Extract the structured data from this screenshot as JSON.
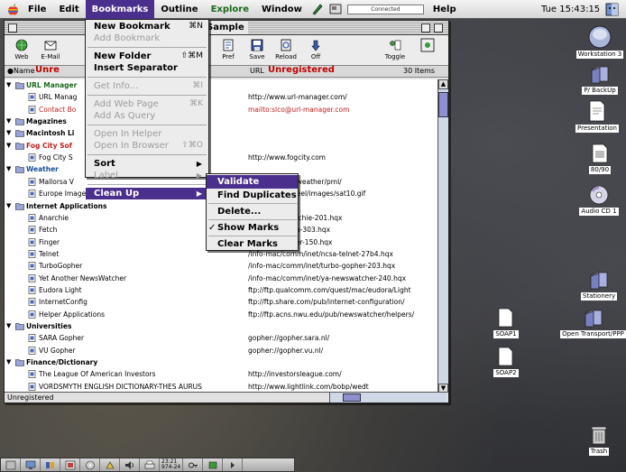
{
  "menubar": {
    "items": [
      "File",
      "Edit",
      "Bookmarks",
      "Outline",
      "Explore",
      "Window"
    ],
    "active": "Bookmarks",
    "connected_status": "Connected",
    "help": "Help",
    "clock": "Tue 15:43:15"
  },
  "window": {
    "title": "Sample",
    "toolbar": [
      {
        "label": "Web",
        "icon": "web-icon"
      },
      {
        "label": "E-Mail",
        "icon": "email-icon"
      },
      {
        "label": "Pref",
        "icon": "pref-icon"
      },
      {
        "label": "Save",
        "icon": "save-icon"
      },
      {
        "label": "Reload",
        "icon": "reload-icon"
      },
      {
        "label": "Off",
        "icon": "off-icon"
      },
      {
        "label": "Toggle",
        "icon": "toggle-icon"
      }
    ],
    "header": {
      "name_col": "Name",
      "unreg_left": "Unre",
      "url_col": "URL",
      "unreg_right": "Unregistered",
      "count": "30 Items"
    },
    "rows": [
      {
        "name": "URL Manager",
        "url": "",
        "kind": "folder",
        "color": "green",
        "indent": 0
      },
      {
        "name": "URL Manag",
        "url": "http://www.url-manager.com/",
        "kind": "item",
        "color": "",
        "indent": 1
      },
      {
        "name": "Contact Bo",
        "url": "mailto:slco@url-manager.com",
        "kind": "item",
        "color": "red",
        "indent": 1
      },
      {
        "name": "Magazines",
        "url": "",
        "kind": "folder",
        "color": "",
        "indent": 0
      },
      {
        "name": "Macintosh Li",
        "url": "",
        "kind": "folder",
        "color": "",
        "indent": 0
      },
      {
        "name": "Fog City Sof",
        "url": "",
        "kind": "folder",
        "color": "red",
        "indent": 0
      },
      {
        "name": "Fog City S",
        "url": "http://www.fogcity.com",
        "kind": "item",
        "color": "",
        "indent": 1
      },
      {
        "name": "Weather",
        "url": "",
        "kind": "folder",
        "color": "blue",
        "indent": 0
      },
      {
        "name": "Mallorsa V",
        "url": "telliteast.com/weather/pml/",
        "kind": "item",
        "color": "",
        "indent": 1
      },
      {
        "name": "Europe Image",
        "url": "eteo.fr:80/tpsreel/images/sat10.gif",
        "kind": "item",
        "color": "",
        "indent": 1
      },
      {
        "name": "Internet Applications",
        "url": "",
        "kind": "folder",
        "color": "",
        "indent": 0
      },
      {
        "name": "Anarchie",
        "url": "omm/inet/anarchie-201.hqx",
        "kind": "item",
        "color": "",
        "indent": 1
      },
      {
        "name": "Fetch",
        "url": "omm/inet/fetch-303.hqx",
        "kind": "item",
        "color": "",
        "indent": 1
      },
      {
        "name": "Finger",
        "url": "omm/inet/finger-150.hqx",
        "kind": "item",
        "color": "",
        "indent": 1
      },
      {
        "name": "Telnet",
        "url": "/info-mac/comm/inet/ncsa-telnet-27b4.hqx",
        "kind": "item",
        "color": "",
        "indent": 1
      },
      {
        "name": "TurboGopher",
        "url": "/info-mac/comm/inet/turbo-gopher-203.hqx",
        "kind": "item",
        "color": "",
        "indent": 1
      },
      {
        "name": "Yet Another NewsWatcher",
        "url": "/info-mac/comm/inet/ya-newswatcher-240.hqx",
        "kind": "item",
        "color": "",
        "indent": 1
      },
      {
        "name": "Eudora Light",
        "url": "ftp://ftp.qualcomm.com/quest/mac/eudora/Light",
        "kind": "item",
        "color": "",
        "indent": 1
      },
      {
        "name": "InternetConfig",
        "url": "ftp://ftp.share.com/pub/internet-configuration/",
        "kind": "item",
        "color": "",
        "indent": 1
      },
      {
        "name": "Helper Applications",
        "url": "ftp://ftp.acns.nwu.edu/pub/newswatcher/helpers/",
        "kind": "item",
        "color": "",
        "indent": 1
      },
      {
        "name": "Universities",
        "url": "",
        "kind": "folder",
        "color": "",
        "indent": 0
      },
      {
        "name": "SARA Gopher",
        "url": "gopher://gopher.sara.nl/",
        "kind": "item",
        "color": "",
        "indent": 1
      },
      {
        "name": "VU Gopher",
        "url": "gopher://gopher.vu.nl/",
        "kind": "item",
        "color": "",
        "indent": 1
      },
      {
        "name": "Finance/Dictionary",
        "url": "",
        "kind": "folder",
        "color": "",
        "indent": 0
      },
      {
        "name": "The League Of American Investors",
        "url": "http://investorsleague.com/",
        "kind": "item",
        "color": "",
        "indent": 1
      },
      {
        "name": "VORDSMYTH ENGLISH DICTIONARY-THES AURUS",
        "url": "http://www.lightlink.com/bobp/wedt",
        "kind": "item",
        "color": "",
        "indent": 1
      }
    ],
    "status": "Unregistered"
  },
  "bookmarks_menu": [
    {
      "label": "New Bookmark",
      "shortcut": "⌘N",
      "disabled": false
    },
    {
      "label": "Add Bookmark",
      "shortcut": "",
      "disabled": true
    },
    {
      "sep": true
    },
    {
      "label": "New Folder",
      "shortcut": "⇧⌘M",
      "disabled": false
    },
    {
      "label": "Insert Separator",
      "shortcut": "",
      "disabled": false
    },
    {
      "sep": true
    },
    {
      "label": "Get Info...",
      "shortcut": "⌘I",
      "disabled": true
    },
    {
      "sep": true
    },
    {
      "label": "Add Web Page",
      "shortcut": "⌘K",
      "disabled": true
    },
    {
      "label": "Add As Query",
      "shortcut": "",
      "disabled": true
    },
    {
      "sep": true
    },
    {
      "label": "Open In Helper",
      "shortcut": "",
      "disabled": true
    },
    {
      "label": "Open In Browser",
      "shortcut": "⇧⌘O",
      "disabled": true
    },
    {
      "sep": true
    },
    {
      "label": "Sort",
      "shortcut": "",
      "disabled": false,
      "submenu": true
    },
    {
      "label": "Label",
      "shortcut": "",
      "disabled": true,
      "submenu": true
    },
    {
      "sep": true
    },
    {
      "label": "Clean Up",
      "shortcut": "",
      "disabled": false,
      "submenu": true,
      "highlight": true
    }
  ],
  "cleanup_submenu": [
    {
      "label": "Validate",
      "highlight": true
    },
    {
      "label": "Find Duplicates"
    },
    {
      "sep": true
    },
    {
      "label": "Delete..."
    },
    {
      "sep": true
    },
    {
      "label": "Show Marks",
      "checked": true
    },
    {
      "sep": true
    },
    {
      "label": "Clear Marks"
    }
  ],
  "desktop_icons": [
    {
      "label": "Workstation 3",
      "icon": "hard-disk-icon"
    },
    {
      "label": "P/ BackUp",
      "icon": "folder-icon"
    },
    {
      "label": "Presentation",
      "icon": "document-icon"
    },
    {
      "label": "80/90",
      "icon": "document-icon"
    },
    {
      "label": "Audio CD 1",
      "icon": "cd-icon"
    },
    {
      "label": "Stationery",
      "icon": "folder-icon"
    },
    {
      "label": "Open Transport/PPP",
      "icon": "folder-icon"
    },
    {
      "label": "SOAP1",
      "icon": "document-icon"
    },
    {
      "label": "SOAP2",
      "icon": "document-icon"
    },
    {
      "label": "Trash",
      "icon": "trash-icon"
    }
  ],
  "control_strip": {
    "readout_top": "23:21",
    "readout_bottom": "974-24"
  },
  "colors": {
    "highlight": "#4b2f8c",
    "unregistered": "#c00000",
    "scroll_thumb": "#8f8fd0"
  }
}
